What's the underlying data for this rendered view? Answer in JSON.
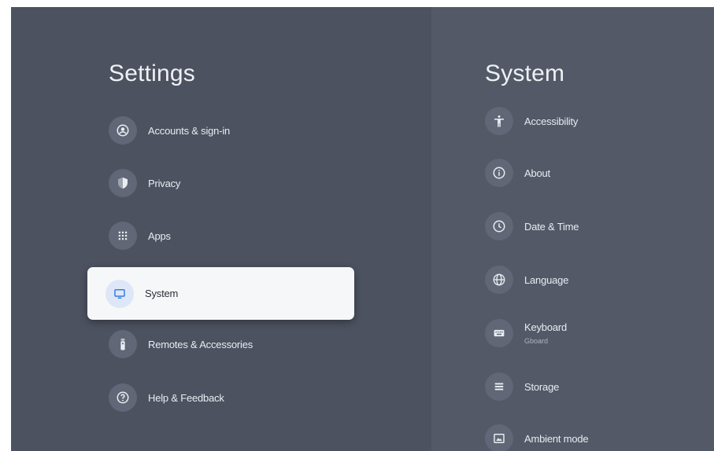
{
  "left": {
    "title": "Settings",
    "items": [
      {
        "label": "Accounts & sign-in",
        "icon": "account-circle-icon"
      },
      {
        "label": "Privacy",
        "icon": "shield-icon"
      },
      {
        "label": "Apps",
        "icon": "apps-grid-icon"
      },
      {
        "label": "System",
        "icon": "tv-icon",
        "selected": true
      },
      {
        "label": "Remotes & Accessories",
        "icon": "remote-icon"
      },
      {
        "label": "Help & Feedback",
        "icon": "help-icon"
      }
    ]
  },
  "right": {
    "title": "System",
    "items": [
      {
        "label": "Accessibility",
        "icon": "accessibility-icon"
      },
      {
        "label": "About",
        "icon": "info-icon"
      },
      {
        "label": "Date & Time",
        "icon": "clock-icon"
      },
      {
        "label": "Language",
        "icon": "globe-icon"
      },
      {
        "label": "Keyboard",
        "sublabel": "Gboard",
        "icon": "keyboard-icon"
      },
      {
        "label": "Storage",
        "icon": "storage-icon"
      },
      {
        "label": "Ambient mode",
        "icon": "ambient-mode-icon"
      }
    ]
  },
  "colors": {
    "background": "#4c5260",
    "panel": "#535967",
    "selected_bg": "#f6f7f9",
    "selected_icon_bg": "#dde7f7",
    "selected_icon": "#3b7be0"
  }
}
